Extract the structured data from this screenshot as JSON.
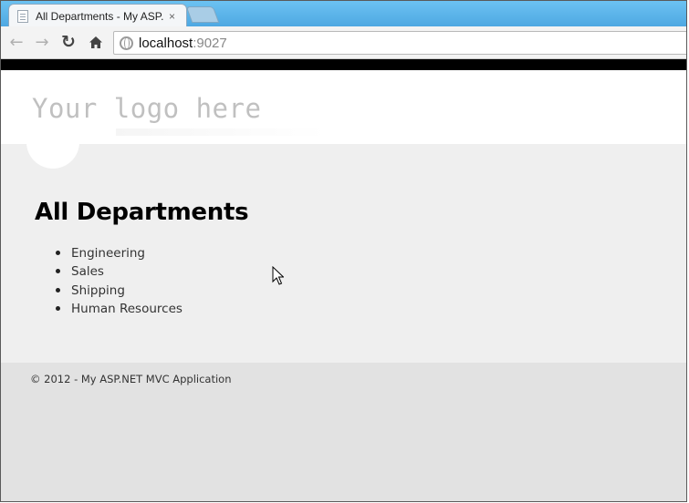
{
  "browser": {
    "tab_title": "All Departments - My ASP.",
    "tab_close": "×",
    "url_host": "localhost",
    "url_port": ":9027",
    "back_icon": "arrow-left-icon",
    "forward_icon": "arrow-right-icon",
    "reload_icon": "reload-icon",
    "home_icon": "home-icon"
  },
  "header": {
    "logo_text": "Your logo here"
  },
  "main": {
    "title": "All Departments",
    "departments": [
      "Engineering",
      "Sales",
      "Shipping",
      "Human Resources"
    ]
  },
  "footer": {
    "text": "© 2012 - My ASP.NET MVC Application"
  },
  "colors": {
    "tabstrip": "#5bb6ec",
    "header_bar": "#000000",
    "main_bg": "#efefef",
    "footer_bg": "#e2e2e2"
  }
}
